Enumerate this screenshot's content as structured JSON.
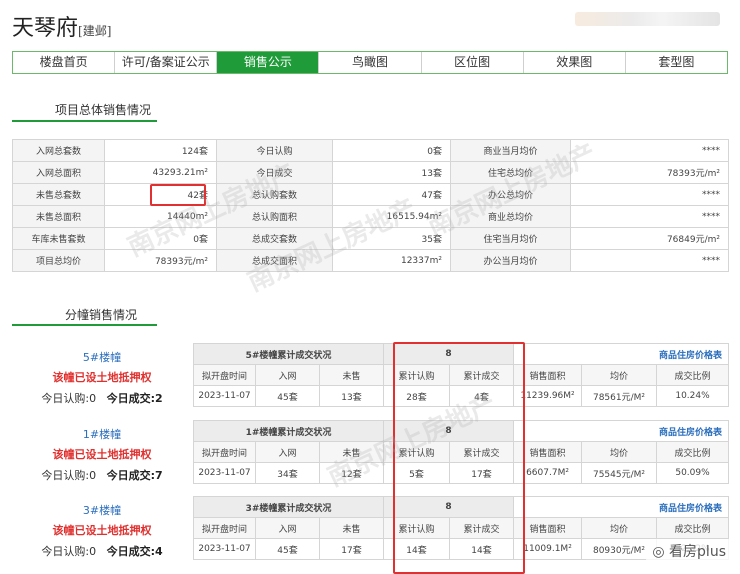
{
  "header": {
    "title": "天琴府",
    "tag": "[建邺]"
  },
  "nav": [
    "楼盘首页",
    "许可/备案证公示",
    "销售公示",
    "鸟瞰图",
    "区位图",
    "效果图",
    "套型图"
  ],
  "overview": {
    "heading": "项目总体销售情况",
    "rows": [
      [
        "入网总套数",
        "124套",
        "今日认购",
        "0套",
        "商业当月均价",
        "****"
      ],
      [
        "入网总面积",
        "43293.21m²",
        "今日成交",
        "13套",
        "住宅总均价",
        "78393元/m²"
      ],
      [
        "未售总套数",
        "42套",
        "总认购套数",
        "47套",
        "办公总均价",
        "****"
      ],
      [
        "未售总面积",
        "14440m²",
        "总认购面积",
        "16515.94m²",
        "商业总均价",
        "****"
      ],
      [
        "车库未售套数",
        "0套",
        "总成交套数",
        "35套",
        "住宅当月均价",
        "76849元/m²"
      ],
      [
        "项目总均价",
        "78393元/m²",
        "总成交面积",
        "12337m²",
        "办公当月均价",
        "****"
      ]
    ]
  },
  "buildings_heading": "分幢销售情况",
  "buildings": [
    {
      "name": "5#楼幢",
      "mortgage": "该幢已设土地抵押权",
      "today_sub_label": "今日认购:",
      "today_sub": "0",
      "today_deal_label": "今日成交:",
      "today_deal": "2",
      "status_title": "5#楼幢累计成交状况",
      "status_num": "8",
      "price_link": "商品住房价格表",
      "cols": [
        "拟开盘时间",
        "入网",
        "未售",
        "累计认购",
        "累计成交",
        "销售面积",
        "均价",
        "成交比例"
      ],
      "vals": [
        "2023-11-07",
        "45套",
        "13套",
        "28套",
        "4套",
        "11239.96M²",
        "78561元/M²",
        "10.24%"
      ]
    },
    {
      "name": "1#楼幢",
      "mortgage": "该幢已设土地抵押权",
      "today_sub_label": "今日认购:",
      "today_sub": "0",
      "today_deal_label": "今日成交:",
      "today_deal": "7",
      "status_title": "1#楼幢累计成交状况",
      "status_num": "8",
      "price_link": "商品住房价格表",
      "cols": [
        "拟开盘时间",
        "入网",
        "未售",
        "累计认购",
        "累计成交",
        "销售面积",
        "均价",
        "成交比例"
      ],
      "vals": [
        "2023-11-07",
        "34套",
        "12套",
        "5套",
        "17套",
        "6607.7M²",
        "75545元/M²",
        "50.09%"
      ]
    },
    {
      "name": "3#楼幢",
      "mortgage": "该幢已设土地抵押权",
      "today_sub_label": "今日认购:",
      "today_sub": "0",
      "today_deal_label": "今日成交:",
      "today_deal": "4",
      "status_title": "3#楼幢累计成交状况",
      "status_num": "8",
      "price_link": "商品住房价格表",
      "cols": [
        "拟开盘时间",
        "入网",
        "未售",
        "累计认购",
        "累计成交",
        "销售面积",
        "均价",
        "成交比例"
      ],
      "vals": [
        "2023-11-07",
        "45套",
        "17套",
        "14套",
        "14套",
        "11009.1M²",
        "80930元/M²",
        "32.32%"
      ]
    }
  ],
  "watermark": "南京网上房地产",
  "badge": "看房plus"
}
